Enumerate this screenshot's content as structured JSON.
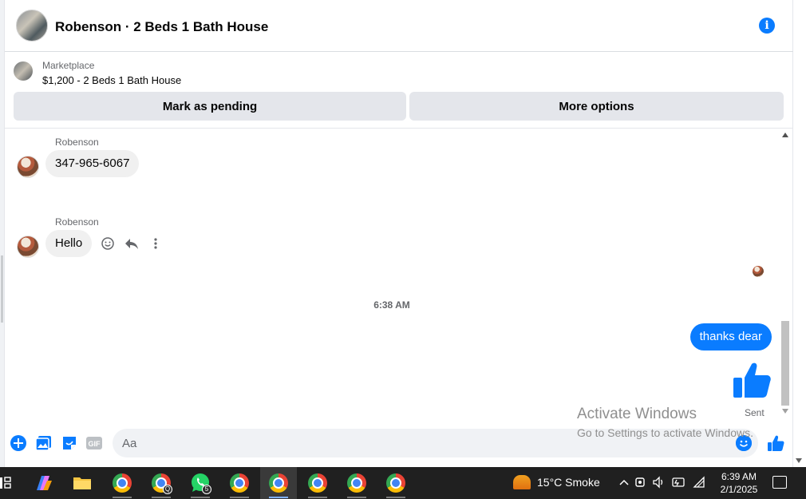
{
  "header": {
    "title": "Robenson · 2 Beds 1 Bath House"
  },
  "listing": {
    "source": "Marketplace",
    "description": "$1,200 - 2 Beds 1 Bath House",
    "mark_pending_label": "Mark as pending",
    "more_options_label": "More options"
  },
  "messages": {
    "items": [
      {
        "sender": "Robenson",
        "text": "347-965-6067"
      },
      {
        "sender": "Robenson",
        "text": "Hello"
      }
    ],
    "timestamp": "6:38 AM",
    "outgoing": "thanks dear",
    "status": "Sent"
  },
  "composer": {
    "placeholder": "Aa",
    "gif_label": "GIF"
  },
  "watermark": {
    "line1": "Activate Windows",
    "line2": "Go to Settings to activate Windows."
  },
  "taskbar": {
    "whatsapp_badge": "5",
    "profile_badge": "Q",
    "weather": "15°C  Smoke",
    "time": "6:39 AM",
    "date": "2/1/2025"
  },
  "colors": {
    "accent": "#0a7cff",
    "taskbar": "#202020"
  }
}
